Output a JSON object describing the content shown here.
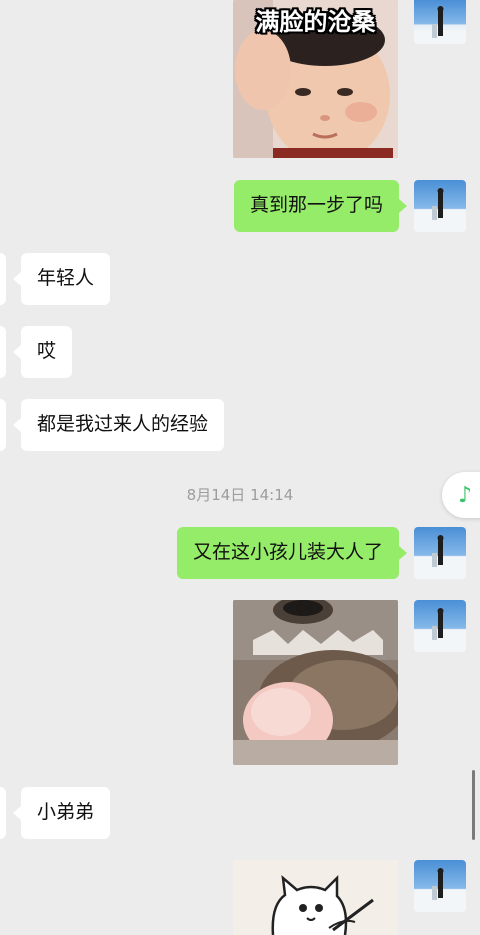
{
  "messages": {
    "sticker_caption": "满脸的沧桑",
    "msg1": "真到那一步了吗",
    "msg2": "年轻人",
    "msg3": "哎",
    "msg4": "都是我过来人的经验",
    "timestamp": "8月14日 14:14",
    "msg5": "又在这小孩儿装大人了",
    "msg6": "小弟弟"
  },
  "icons": {
    "music": "music-note-icon"
  },
  "colors": {
    "background": "#ececec",
    "sent_bubble": "#95ec69",
    "received_bubble": "#ffffff",
    "music_accent": "#3ac36d"
  }
}
